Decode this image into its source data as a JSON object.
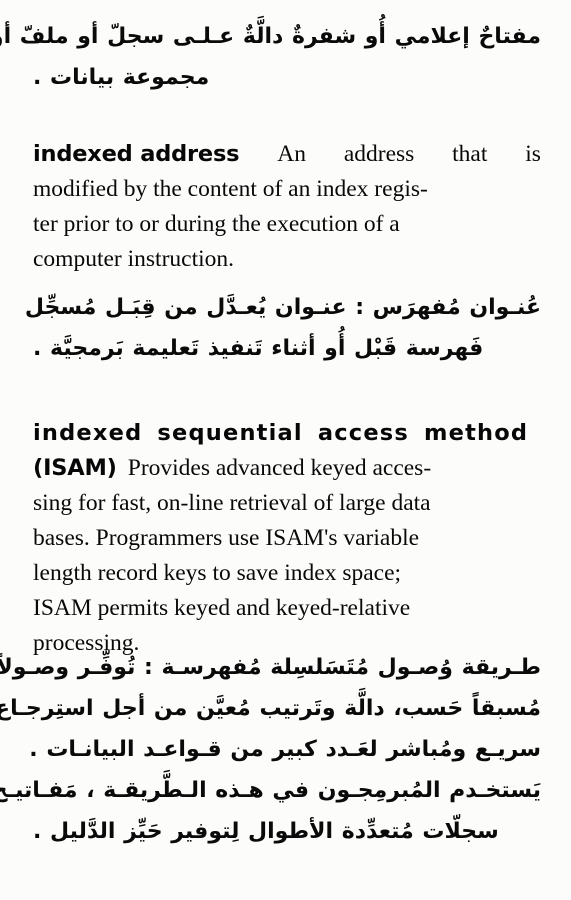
{
  "page": {
    "type": "dictionary-page-scan",
    "language_pair": "English-Arabic",
    "background_color": "#fcfcfb",
    "text_color": "#0a0a0a"
  },
  "arabic_definition_1": {
    "lines": [
      "مفتاحٌ إعلامي أُو شفرةٌ دالَّةٌ عـلـى سجلّ أو ملفّ أو",
      "مجموعة بيانات ."
    ]
  },
  "entry_1": {
    "headword": "indexed address",
    "lines": [
      [
        "An",
        "address",
        "that",
        "is"
      ],
      [
        "modified by the content of an index regis-"
      ],
      [
        "ter prior to or during the execution of a"
      ],
      [
        "computer instruction."
      ]
    ],
    "definition_text": "An address that is modified by the content of an index register prior to or during the execution of a computer instruction."
  },
  "arabic_definition_2": {
    "lines": [
      "عُنـوان مُفهرَس : عنـوان يُعـدَّل من قِبَـل مُسجِّل",
      "فَهرسة قَبْل أُو أثناء تَنفيذ تَعليمة بَرمجيَّة ."
    ]
  },
  "entry_2": {
    "headword_line_1": "indexed sequential access method",
    "headword_line_2": "(ISAM)",
    "lines": [
      [
        "Provides advanced keyed acces-"
      ],
      [
        "sing for fast, on-line retrieval of large data"
      ],
      [
        "bases. Programmers use ISAM's variable"
      ],
      [
        "length record keys to save index space;"
      ],
      [
        "ISAM permits keyed and keyed-relative"
      ],
      [
        "processing."
      ]
    ],
    "definition_text": "Provides advanced keyed accessing for fast, on-line retrieval of large data bases. Programmers use ISAM's variable length record keys to save index space; ISAM permits keyed and keyed-relative processing."
  },
  "arabic_definition_3": {
    "lines": [
      "طـريقة وُصـول مُتَسَلسِلة مُفهرسـة : تُوفِّـر وصـولاً",
      "مُسبقاً حَسب، دالَّة وتَرتيب مُعيَّن من أجل استِرجـاع",
      "سريـع ومُباشر لعَـدد كبير من قـواعـد البيانـات .",
      "يَستخـدم المُبرمِجـون في هـذه الـطَّريقـة ، مَفـاتيـح",
      "سجلّات مُتعدِّدة الأطوال لِتوفير حَيِّز الدَّليل ."
    ]
  }
}
